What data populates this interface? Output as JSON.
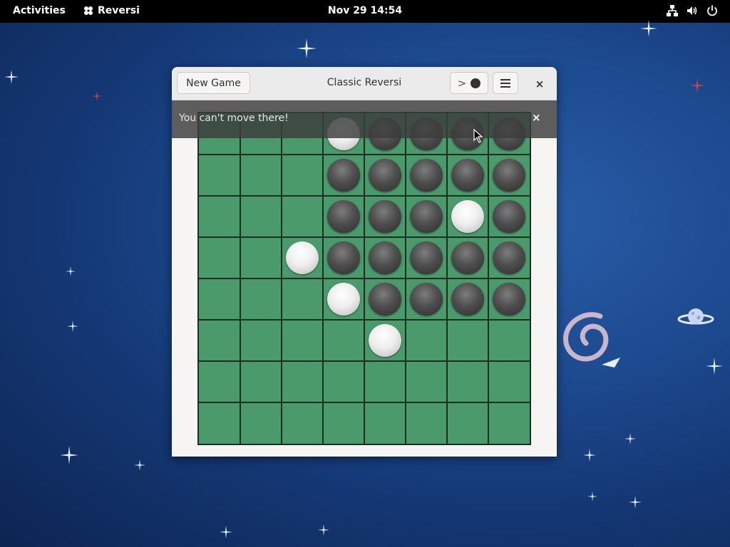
{
  "topbar": {
    "activities": "Activities",
    "app_name": "Reversi",
    "clock": "Nov 29  14:54"
  },
  "window": {
    "title": "Classic Reversi",
    "new_game_label": "New Game",
    "turn_chevron": ">",
    "notification": "You can't move there!",
    "close_glyph": "×",
    "notice_close_glyph": "×"
  },
  "board": {
    "size": 8,
    "rows": [
      "...WBBBB",
      "...BBBBB",
      "...BBBWB",
      "..WBBBBB",
      "...WBBBB",
      "....W...",
      "........",
      "........"
    ]
  },
  "colors": {
    "board_green": "#4a9a6c",
    "grid_line": "#1b2e22",
    "topbar": "#000000",
    "desktop_blue": "#1d4a90"
  }
}
